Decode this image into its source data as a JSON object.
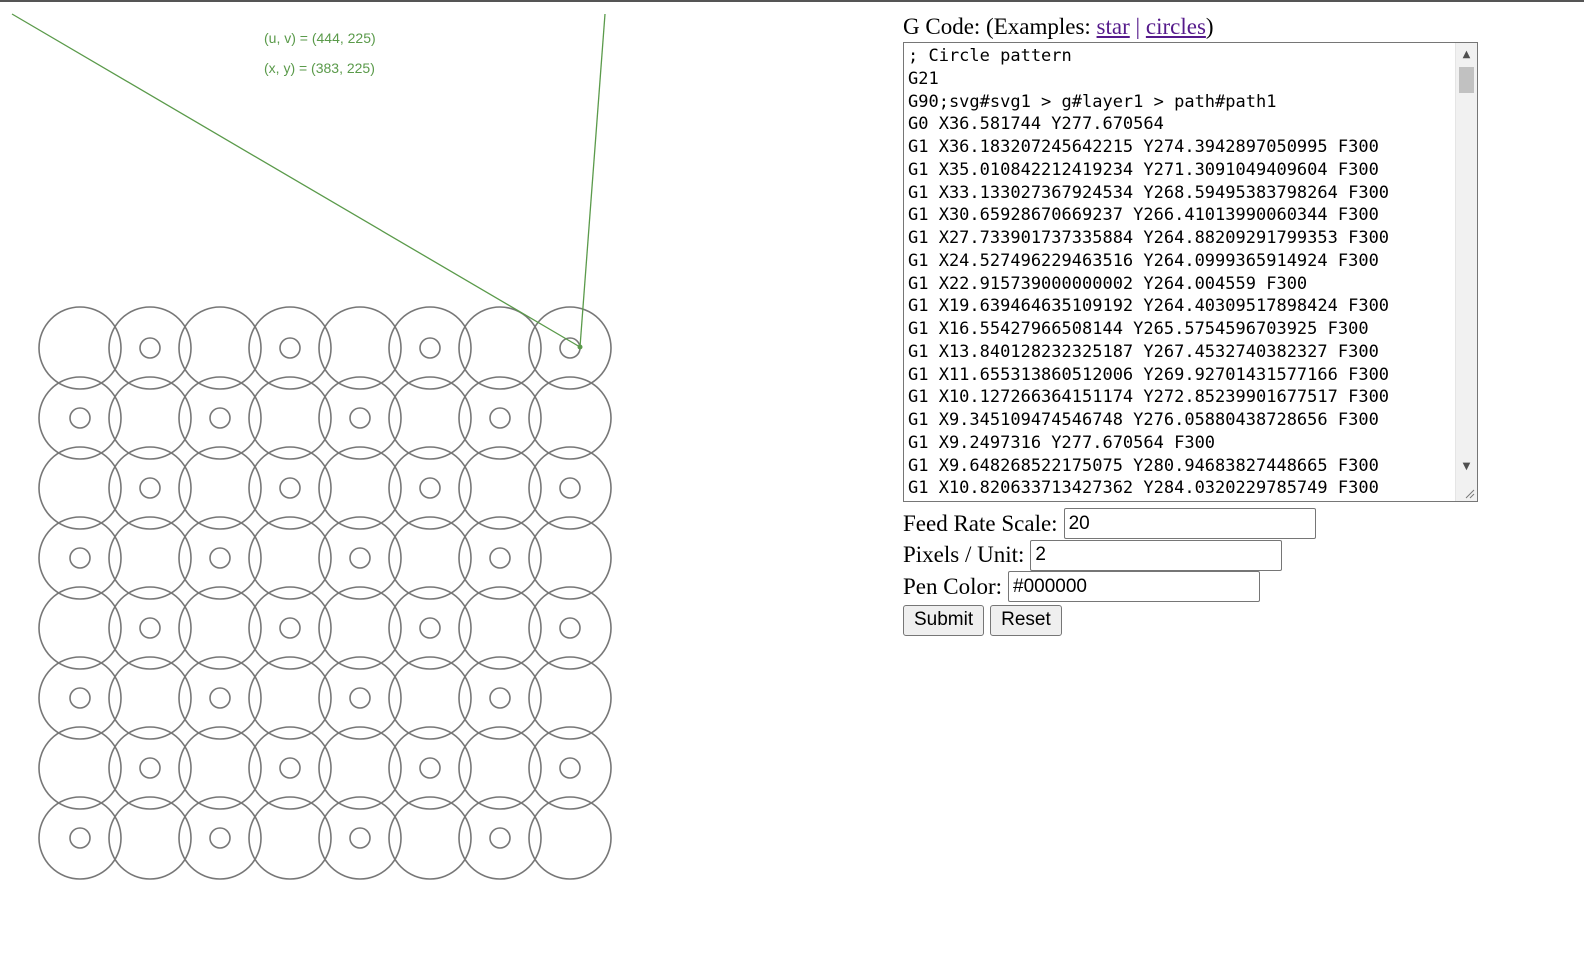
{
  "canvas": {
    "uv_readout": "(u, v) = (444, 225)",
    "xy_readout": "(x, y) = (383, 225)",
    "pattern": {
      "rows": 8,
      "cols": 8,
      "has_inner_ring": [
        [
          false,
          true,
          false,
          true,
          false,
          true,
          false,
          true
        ],
        [
          true,
          false,
          true,
          false,
          true,
          false,
          true,
          false
        ],
        [
          false,
          true,
          false,
          true,
          false,
          true,
          false,
          true
        ],
        [
          true,
          false,
          true,
          false,
          true,
          false,
          true,
          false
        ],
        [
          false,
          true,
          false,
          true,
          false,
          true,
          false,
          true
        ],
        [
          true,
          false,
          true,
          false,
          true,
          false,
          true,
          false
        ],
        [
          false,
          true,
          false,
          true,
          false,
          true,
          false,
          true
        ],
        [
          true,
          false,
          true,
          false,
          true,
          false,
          true,
          false
        ]
      ]
    },
    "colors": {
      "circle_stroke": "#777777",
      "guide_line": "#5a9a4a",
      "readout_text": "#5a9a4a"
    }
  },
  "gcode": {
    "label": "G Code: (Examples: ",
    "example_star": "star",
    "separator": "|",
    "example_circles": "circles",
    "label_close": ")",
    "text": "; Circle pattern\nG21\nG90;svg#svg1 > g#layer1 > path#path1\nG0 X36.581744 Y277.670564\nG1 X36.183207245642215 Y274.3942897050995 F300\nG1 X35.010842212419234 Y271.3091049409604 F300\nG1 X33.133027367924534 Y268.59495383798264 F300\nG1 X30.65928670669237 Y266.41013990060344 F300\nG1 X27.733901737335884 Y264.88209291799353 F300\nG1 X24.527496229463516 Y264.0999365914924 F300\nG1 X22.915739000000002 Y264.004559 F300\nG1 X19.639464635109192 Y264.40309517898424 F300\nG1 X16.55427966508144 Y265.5754596703925 F300\nG1 X13.840128232325187 Y267.4532740382327 F300\nG1 X11.655313860512006 Y269.92701431577166 F300\nG1 X10.127266364151174 Y272.85239901677517 F300\nG1 X9.345109474546748 Y276.05880438728656 F300\nG1 X9.2497316 Y277.670564 F300\nG1 X9.648268522175075 Y280.94683827448665 F300\nG1 X10.820633713427362 Y284.0320229785749 F300"
  },
  "form": {
    "feed_rate_label": "Feed Rate Scale:",
    "feed_rate_value": "20",
    "pixels_unit_label": "Pixels / Unit:",
    "pixels_unit_value": "2",
    "pen_color_label": "Pen Color:",
    "pen_color_value": "#000000",
    "submit_label": "Submit",
    "reset_label": "Reset"
  },
  "icons": {
    "scroll_up": "scroll-up-arrow-icon",
    "scroll_down": "scroll-down-arrow-icon",
    "resize": "resize-grip-icon"
  }
}
